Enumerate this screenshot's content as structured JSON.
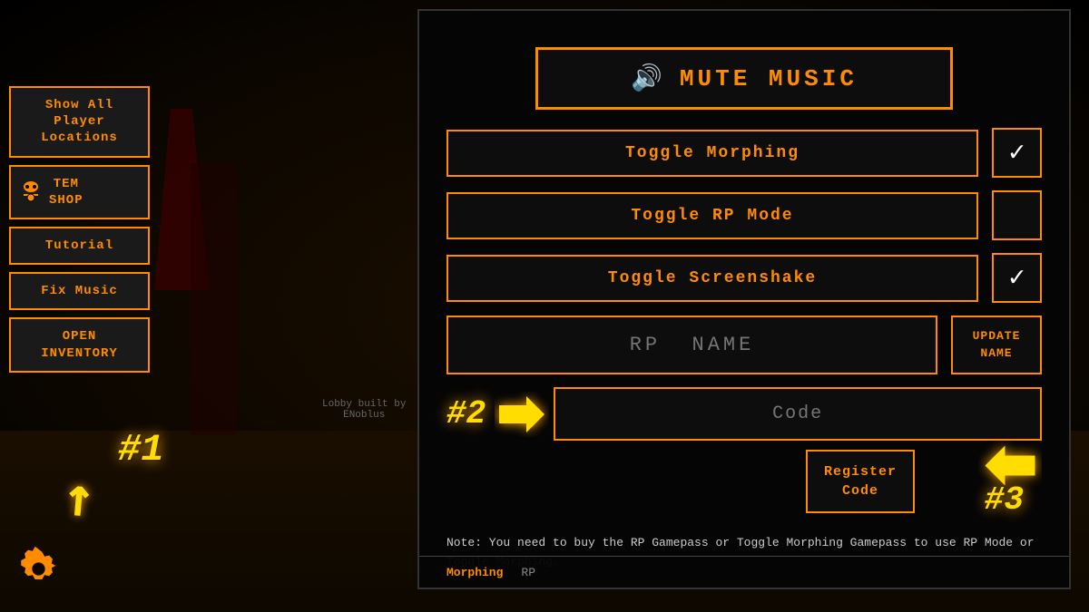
{
  "background": {
    "lobby_text_line1": "Lobby built by",
    "lobby_text_line2": "ENoblus"
  },
  "sidebar": {
    "show_all_btn": "Show All\nPlayer\nLocations",
    "show_all_label": "Show All",
    "show_all_line2": "Player",
    "show_all_line3": "Locations",
    "tem_shop_label": "TEM\nSHOP",
    "tem_label": "TEM",
    "shop_label": "SHOP",
    "tutorial_label": "Tutorial",
    "fix_music_label": "Fix Music",
    "open_inventory_label": "OPEN\nINVENTORY",
    "open_label": "OPEN",
    "inventory_label": "INVENTORY"
  },
  "labels": {
    "hash1": "#1",
    "hash2": "#2",
    "hash3": "#3"
  },
  "panel": {
    "mute_music_label": "MUTE MUSIC",
    "toggle_morphing_label": "Toggle Morphing",
    "toggle_rp_mode_label": "Toggle RP Mode",
    "toggle_screenshake_label": "Toggle Screenshake",
    "rp_name_placeholder": "RP  NAME",
    "update_name_label": "UPDATE NAME",
    "code_placeholder": "Code",
    "register_code_label": "Register\nCode",
    "register_line1": "Register",
    "register_line2": "Code",
    "note_text": "Note:  You need to buy the RP Gamepass or Toggle\nMorphing Gamepass to use RP Mode or Toggle Morphing.",
    "checkboxes": {
      "morphing_checked": true,
      "rp_mode_checked": false,
      "screenshake_checked": true
    },
    "bottom_tabs": [
      {
        "label": "Morphing",
        "active": true
      },
      {
        "label": "RP",
        "active": false
      }
    ]
  },
  "icons": {
    "speaker": "🔊",
    "gear": "⚙",
    "checkmark": "✓"
  }
}
